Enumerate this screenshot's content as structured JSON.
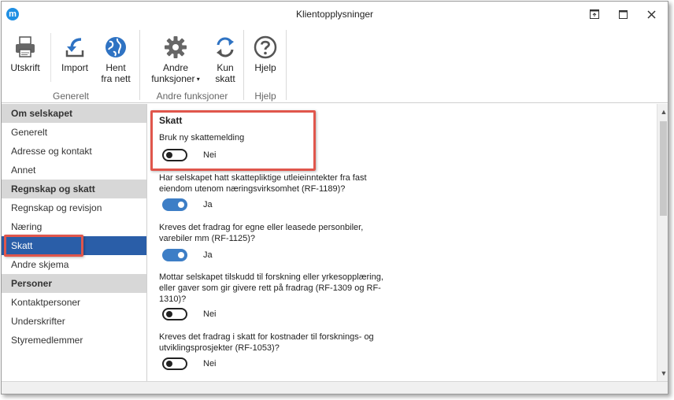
{
  "window": {
    "title": "Klientopplysninger",
    "app_logo": "m",
    "buttons": [
      "restore-icon",
      "maximize-icon",
      "close-icon"
    ]
  },
  "ribbon": {
    "groups": [
      {
        "label": "Generelt",
        "buttons": [
          {
            "label": "Utskrift",
            "icon": "printer-icon"
          },
          {
            "label": "Import",
            "icon": "import-arrow-icon"
          },
          {
            "label": "Hent\nfra nett",
            "icon": "globe-icon"
          }
        ]
      },
      {
        "label": "Andre funksjoner",
        "buttons": [
          {
            "label": "Andre\nfunksjoner",
            "icon": "gear-icon",
            "dropdown": true
          },
          {
            "label": "Kun\nskatt",
            "icon": "sync-icon"
          }
        ]
      },
      {
        "label": "Hjelp",
        "buttons": [
          {
            "label": "Hjelp",
            "icon": "help-icon"
          }
        ]
      }
    ]
  },
  "nav": {
    "sections": [
      {
        "header": "Om selskapet",
        "items": [
          "Generelt",
          "Adresse og kontakt",
          "Annet"
        ]
      },
      {
        "header": "Regnskap og skatt",
        "items": [
          "Regnskap og revisjon",
          "Næring",
          "Skatt",
          "Andre skjema"
        ]
      },
      {
        "header": "Personer",
        "items": [
          "Kontaktpersoner",
          "Underskrifter",
          "Styremedlemmer"
        ]
      }
    ],
    "active": "Skatt"
  },
  "content": {
    "section_title": "Skatt",
    "questions": [
      {
        "text": "Bruk ny skattemelding",
        "value": false,
        "value_label": "Nei"
      },
      {
        "text": "Har selskapet hatt skattepliktige utleieinntekter fra fast eiendom utenom næringsvirksomhet (RF-1189)?",
        "value": true,
        "value_label": "Ja"
      },
      {
        "text": "Kreves det fradrag for egne eller leasede personbiler, varebiler mm (RF-1125)?",
        "value": true,
        "value_label": "Ja"
      },
      {
        "text": "Mottar selskapet tilskudd til forskning eller yrkesopplæring, eller gaver som gir givere rett på fradrag (RF-1309 og RF-1310)?",
        "value": false,
        "value_label": "Nei"
      },
      {
        "text": "Kreves det fradrag i skatt for kostnader til forsknings- og utviklingsprosjekter (RF-1053)?",
        "value": false,
        "value_label": "Nei"
      }
    ]
  },
  "colors": {
    "nav_active": "#2a5ea8",
    "toggle_on": "#3d7ec6",
    "highlight": "#e0564c"
  }
}
